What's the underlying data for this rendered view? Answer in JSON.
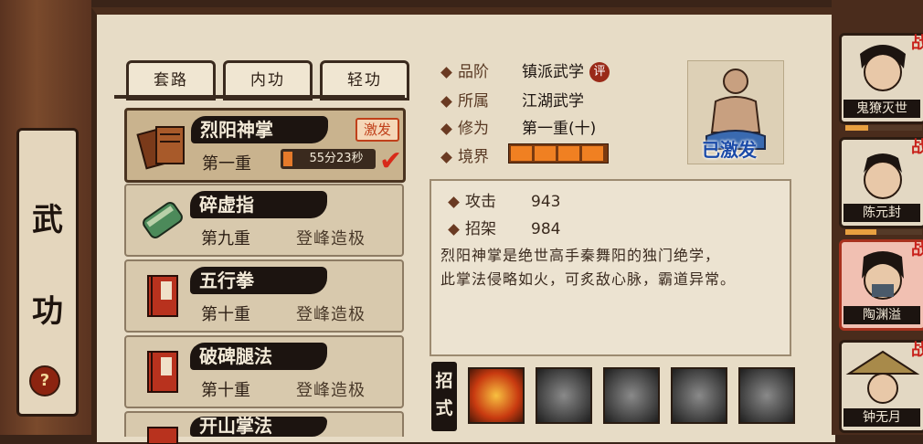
{
  "left_panel": {
    "title_char_1": "武",
    "title_char_2": "功",
    "help_icon": "?"
  },
  "tabs": [
    {
      "label": "套路"
    },
    {
      "label": "内功"
    },
    {
      "label": "轻功"
    }
  ],
  "martial_list": [
    {
      "name": "烈阳神掌",
      "level": "第一重",
      "badge": "激发",
      "timer": "55分23秒",
      "icon": "book-scroll-icon",
      "selected": true
    },
    {
      "name": "碎虚指",
      "level": "第九重",
      "status": "登峰造极",
      "icon": "green-scroll-icon"
    },
    {
      "name": "五行拳",
      "level": "第十重",
      "status": "登峰造极",
      "icon": "red-book-icon"
    },
    {
      "name": "破碑腿法",
      "level": "第十重",
      "status": "登峰造极",
      "icon": "red-book-icon"
    },
    {
      "name": "开山掌法",
      "icon": "red-book-icon"
    }
  ],
  "info": {
    "rank_label": "品阶",
    "rank_value": "镇派武学",
    "rank_tag": "评",
    "belong_label": "所属",
    "belong_value": "江湖武学",
    "cultivation_label": "修为",
    "cultivation_value": "第一重(十)",
    "realm_label": "境界",
    "activated_text": "已激发"
  },
  "stats": {
    "attack_label": "攻击",
    "attack_value": "943",
    "parry_label": "招架",
    "parry_value": "984",
    "desc_line1": "烈阳神掌是绝世高手秦舞阳的独门绝学，",
    "desc_line2": "此掌法侵略如火，可炙敌心脉，霸道异常。"
  },
  "moves": {
    "label_1": "招",
    "label_2": "式"
  },
  "characters": [
    {
      "name": "鬼獠灭世",
      "mark": "战"
    },
    {
      "name": "陈元封",
      "mark": "战"
    },
    {
      "name": "陶渊溢",
      "mark": "战",
      "selected": true
    },
    {
      "name": "钟无月",
      "mark": "战"
    }
  ]
}
